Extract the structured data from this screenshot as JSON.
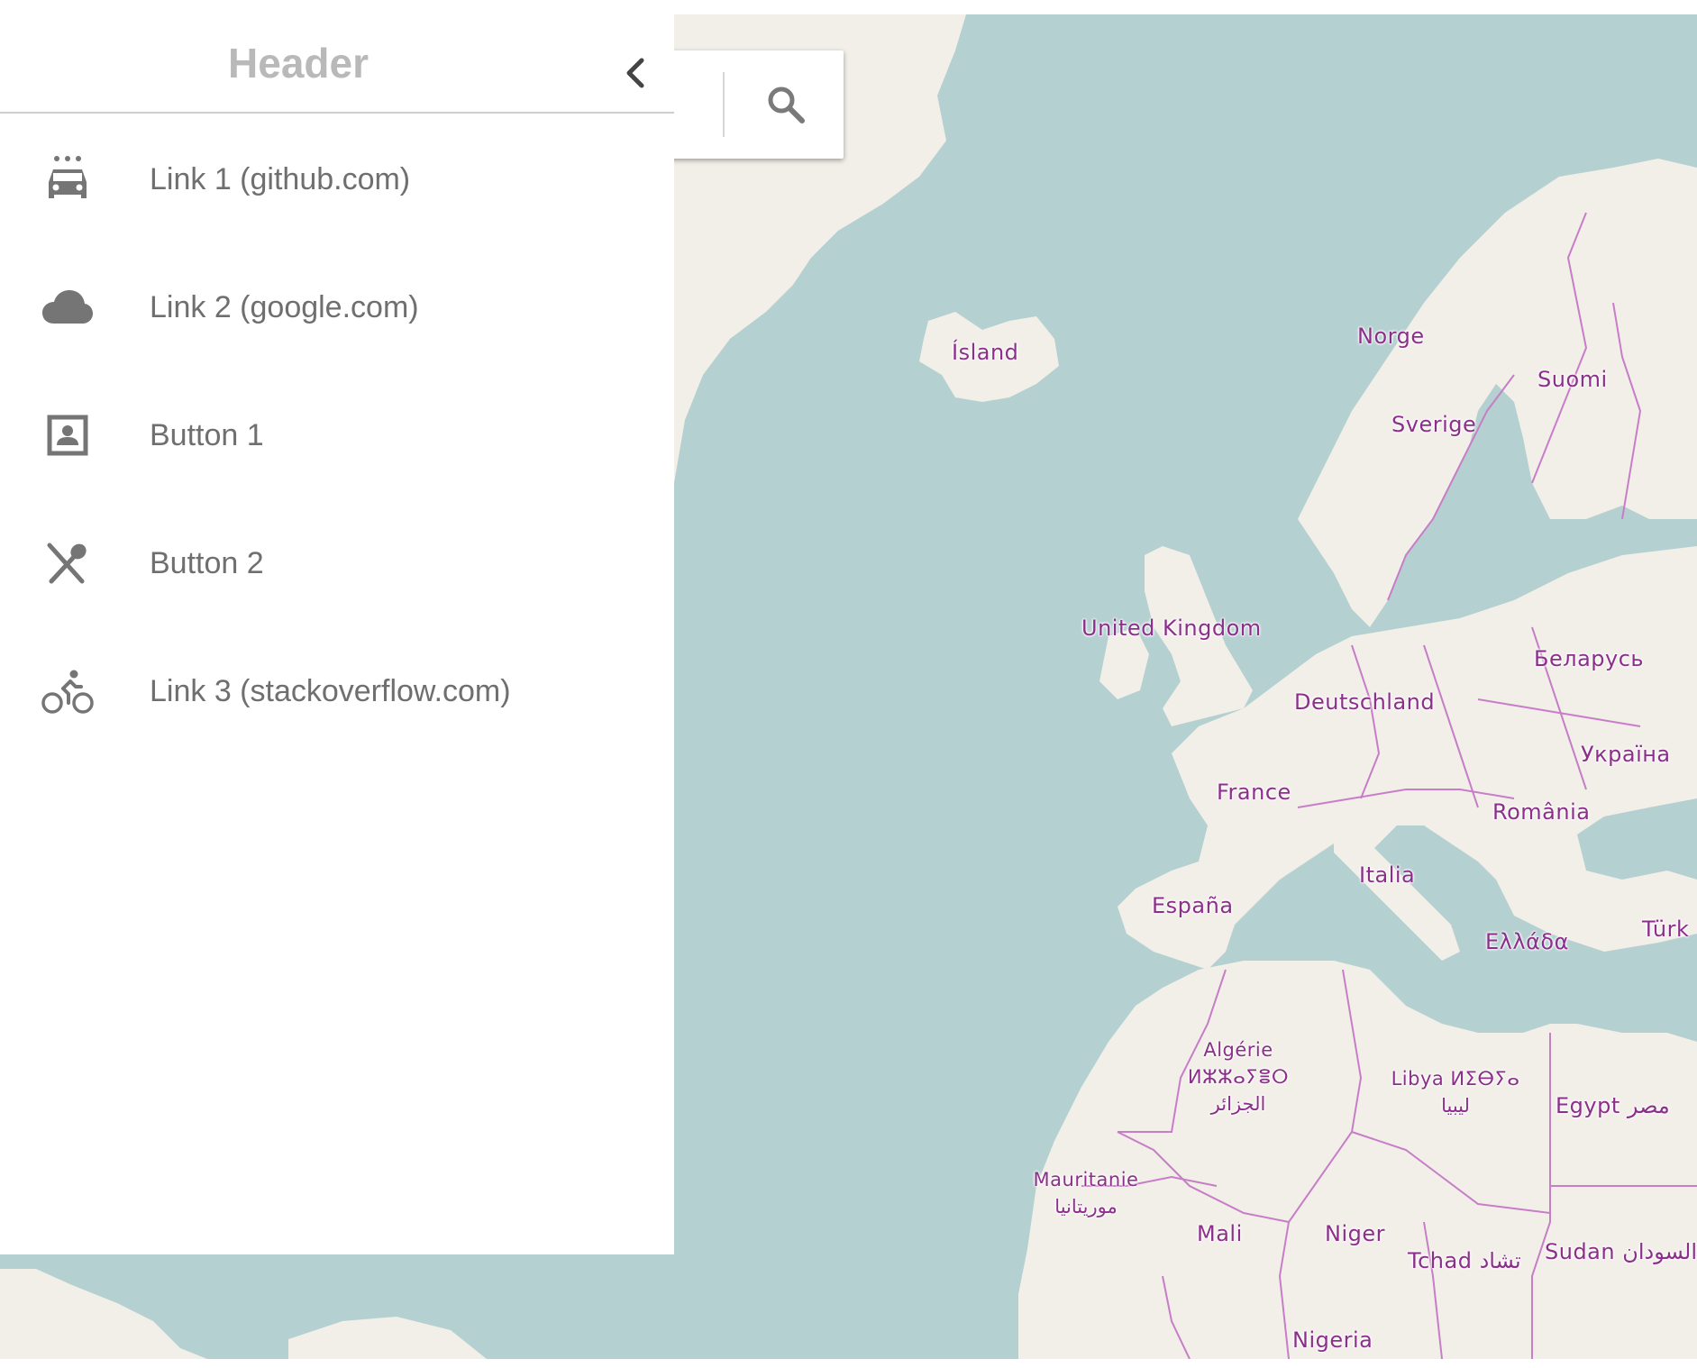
{
  "sidebar": {
    "header_title": "Header",
    "items": [
      {
        "label": "Link 1 (github.com)",
        "icon": "car-wash-icon"
      },
      {
        "label": "Link 2 (google.com)",
        "icon": "cloud-icon"
      },
      {
        "label": "Button 1",
        "icon": "contact-card-icon"
      },
      {
        "label": "Button 2",
        "icon": "restaurant-icon"
      },
      {
        "label": "Link 3 (stackoverflow.com)",
        "icon": "bicycle-icon"
      }
    ]
  },
  "search": {
    "placeholder": "",
    "value": "",
    "icon": "search-icon"
  },
  "map": {
    "labels": {
      "island": "Ísland",
      "norge": "Norge",
      "suomi": "Suomi",
      "sverige": "Sverige",
      "united_kingdom": "United Kingdom",
      "belarus": "Беларусь",
      "deutschland": "Deutschland",
      "ukraina": "Україна",
      "france": "France",
      "romania": "România",
      "italia": "Italia",
      "espana": "España",
      "turkiye": "Türk",
      "ellada": "Ελλάδα",
      "algerie": "Algérie",
      "algerie_tifinagh": "ⵍⵣⵣⴰⵢⴻⵔ",
      "algerie_arabic": "الجزائر",
      "libya": "Libya ⵍⵉⴱⵢⴰ",
      "libya_arabic": "ليبيا",
      "egypt": "Egypt مصر",
      "mauritanie": "Mauritanie",
      "mauritanie_arabic": "موريتانيا",
      "mali": "Mali",
      "niger": "Niger",
      "tchad": "Tchad تشاد",
      "sudan": "Sudan السودان",
      "nigeria": "Nigeria"
    },
    "colors": {
      "water": "#b5d0d0",
      "land": "#f2efe9",
      "border": "#c77dc7",
      "label": "#8c2f8a"
    }
  }
}
